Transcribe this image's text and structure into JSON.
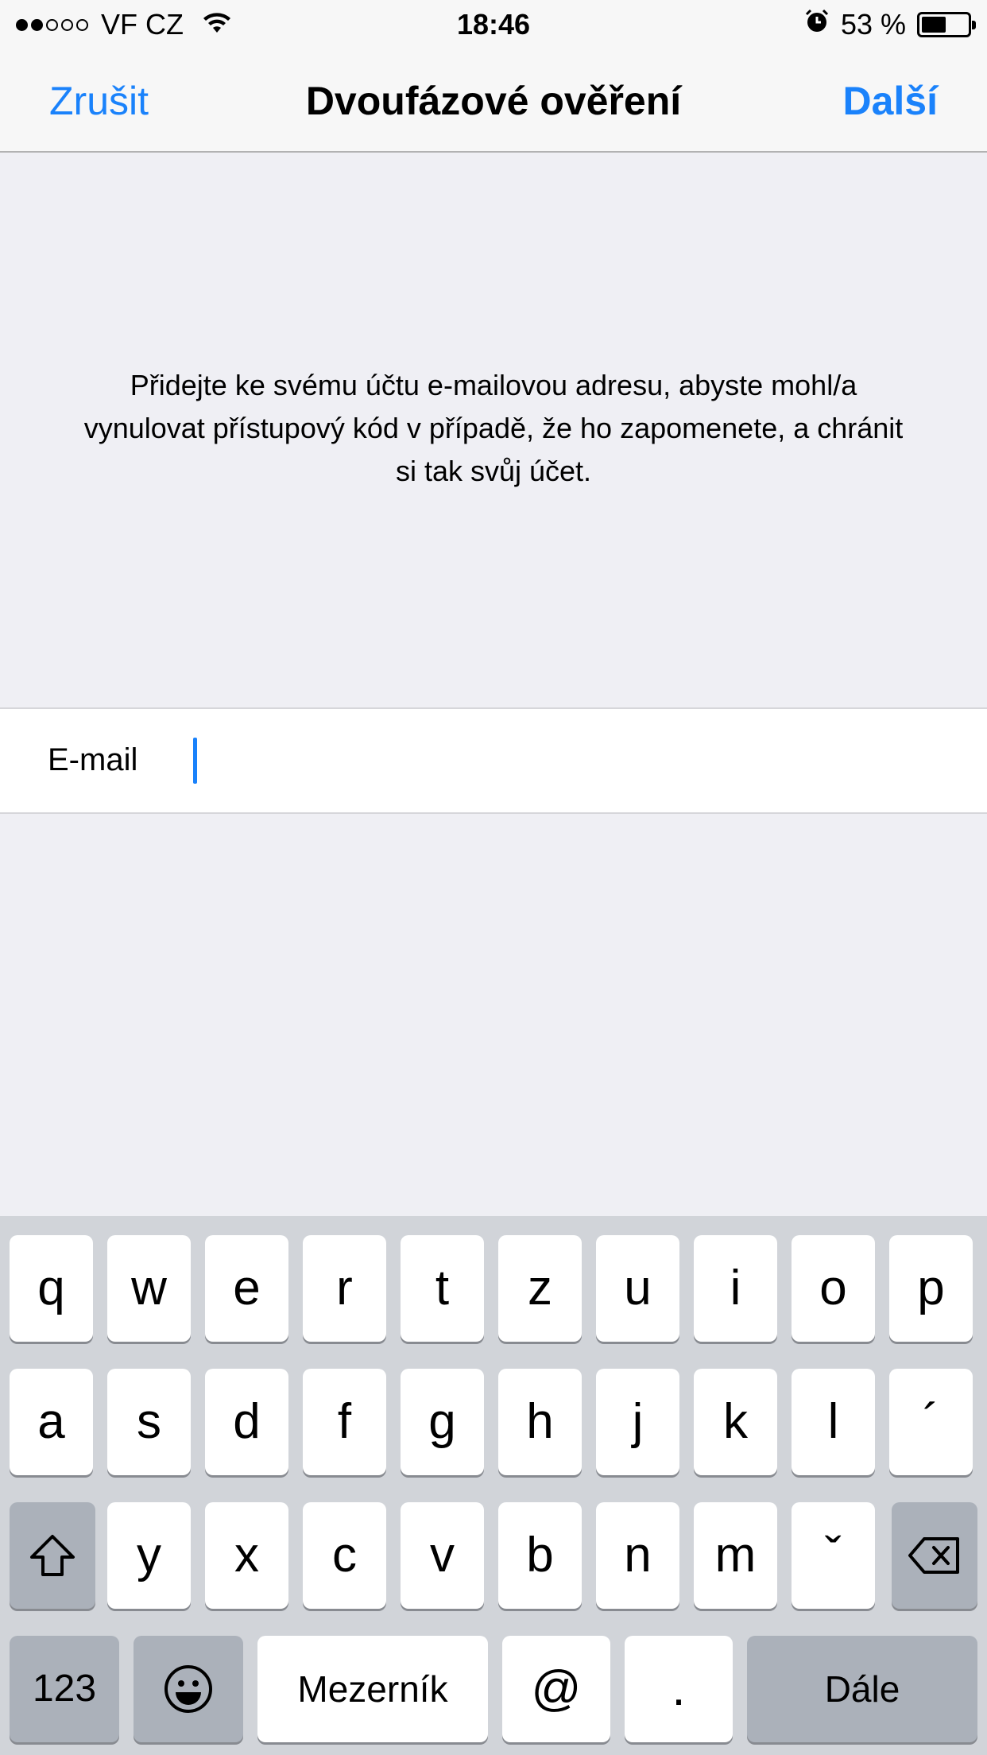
{
  "status_bar": {
    "carrier": "VF CZ",
    "time": "18:46",
    "battery_percent": "53 %",
    "battery_level": 0.53,
    "signal_strength": 2,
    "signal_max": 5
  },
  "nav": {
    "cancel_label": "Zrušit",
    "title": "Dvoufázové ověření",
    "next_label": "Další"
  },
  "description": "Přidejte ke svému účtu e-mailovou adresu, abyste mohl/a vynulovat přístupový kód v případě, že ho zapomenete, a chránit si tak svůj účet.",
  "email": {
    "label": "E-mail",
    "value": "",
    "placeholder": ""
  },
  "keyboard": {
    "row1": [
      "q",
      "w",
      "e",
      "r",
      "t",
      "z",
      "u",
      "i",
      "o",
      "p"
    ],
    "row2": [
      "a",
      "s",
      "d",
      "f",
      "g",
      "h",
      "j",
      "k",
      "l",
      "´"
    ],
    "row3": [
      "y",
      "x",
      "c",
      "v",
      "b",
      "n",
      "m",
      "ˇ"
    ],
    "numbers_label": "123",
    "space_label": "Mezerník",
    "at_label": "@",
    "dot_label": ".",
    "return_label": "Dále"
  },
  "colors": {
    "accent": "#1a82fb",
    "background": "#efeff4",
    "keyboard": "#d1d4d9"
  }
}
